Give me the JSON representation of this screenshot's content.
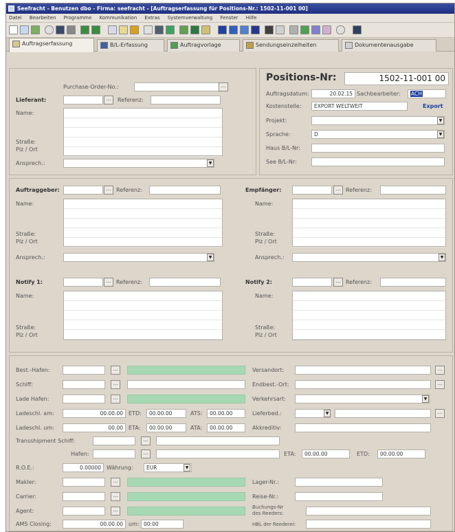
{
  "window": {
    "title": "Seefracht - Benutzen dbo - Firma: seefracht - [Auftragserfassung für Positions-Nr.: 1502-11-001 00]"
  },
  "menu": [
    "Datei",
    "Bearbeiten",
    "Programme",
    "Kommunikation",
    "Extras",
    "Systemverwaltung",
    "Fenster",
    "Hilfe"
  ],
  "tabs": [
    {
      "label": "Auftragserfassung",
      "active": true
    },
    {
      "label": "B/L-Erfassung"
    },
    {
      "label": "Auftragvorlage"
    },
    {
      "label": "Sendungseinzelheiten"
    },
    {
      "label": "Dokumentenausgabe"
    }
  ],
  "top_left": {
    "purchase_order_label": "Purchase-Order-No.:",
    "lieferant_label": "Lieferant:",
    "referenz_label": "Referenz:",
    "name_label": "Name:",
    "strasse_label": "Straße:",
    "plz_label": "Plz / Ort",
    "ansprech_label": "Ansprech.:"
  },
  "position": {
    "title": "Positions-Nr:",
    "number": "1502-11-001 00",
    "auftragsdatum_label": "Auftragsdatum:",
    "auftragsdatum": "20.02.15",
    "sachbearbeiter_label": "Sachbearbeiter:",
    "sachbearbeiter": "ACH",
    "kostenstelle_label": "Kostenstelle:",
    "kostenstelle": "EXPORT WELTWEIT",
    "export_link": "Export",
    "projekt_label": "Projekt:",
    "sprache_label": "Sprache:",
    "sprache": "D",
    "haus_bl_label": "Haus B/L-Nr:",
    "see_bl_label": "See  B/L-Nr:"
  },
  "middle": {
    "auftraggeber_label": "Auftraggeber:",
    "empfaenger_label": "Empfänger:",
    "notify1_label": "Notify 1:",
    "notify2_label": "Notify 2:",
    "referenz_label": "Referenz:",
    "name_label": "Name:",
    "strasse_label": "Straße:",
    "plz_label": "Plz / Ort",
    "ansprech_label": "Ansprech.:",
    "ansprech2_label": "Ansprech.:"
  },
  "bottom": {
    "best_hafen_label": "Best.-Hafen:",
    "schiff_label": "Schiff:",
    "lade_hafen_label": "Lade Hafen:",
    "ladeschl_am_label": "Ladeschl. am:",
    "ladeschl_am": "00.00.00",
    "etd_label": "ETD:",
    "etd": "00.00.00",
    "ats_label": "ATS:",
    "ats": "00.00.00",
    "ladeschl_um_label": "Ladeschl. um:",
    "ladeschl_um": "00.00",
    "eta_label": "ETA:",
    "eta": "00.00.00",
    "ata_label": "ATA:",
    "ata": "00.00.00",
    "transshipment_label": "Transshipment  Schiff:",
    "hafen_label": "Hafen:",
    "eta2_label": "ETA:",
    "eta2": "00.00.00",
    "etd2_label": "ETD:",
    "etd2": "00.00.00",
    "roe_label": "R.O.E.:",
    "roe": "0.00000",
    "waehrung_label": "Währung:",
    "waehrung": "EUR",
    "makler_label": "Makler:",
    "carrier_label": "Carrier:",
    "agent_label": "Agent:",
    "amd_closing_label": "AMS Closing:",
    "amd_closing": "00.00.00",
    "um_label": "um:",
    "um": "00:00",
    "versandort_label": "Versandort:",
    "endbest_ort_label": "Endbest.-Ort:",
    "verkehrsart_label": "Verkehrsart:",
    "lieferbed_label": "Lieferbed.:",
    "akkreditiv_label": "Akkreditiv:",
    "lager_nr_label": "Lager-Nr.:",
    "reise_nr_label": "Reise-Nr.:",
    "buchungs_nr_label": "Buchungs-Nr",
    "des_reeders_label": "des Reeders:",
    "hbl_label": "HBL der Reederei:"
  }
}
